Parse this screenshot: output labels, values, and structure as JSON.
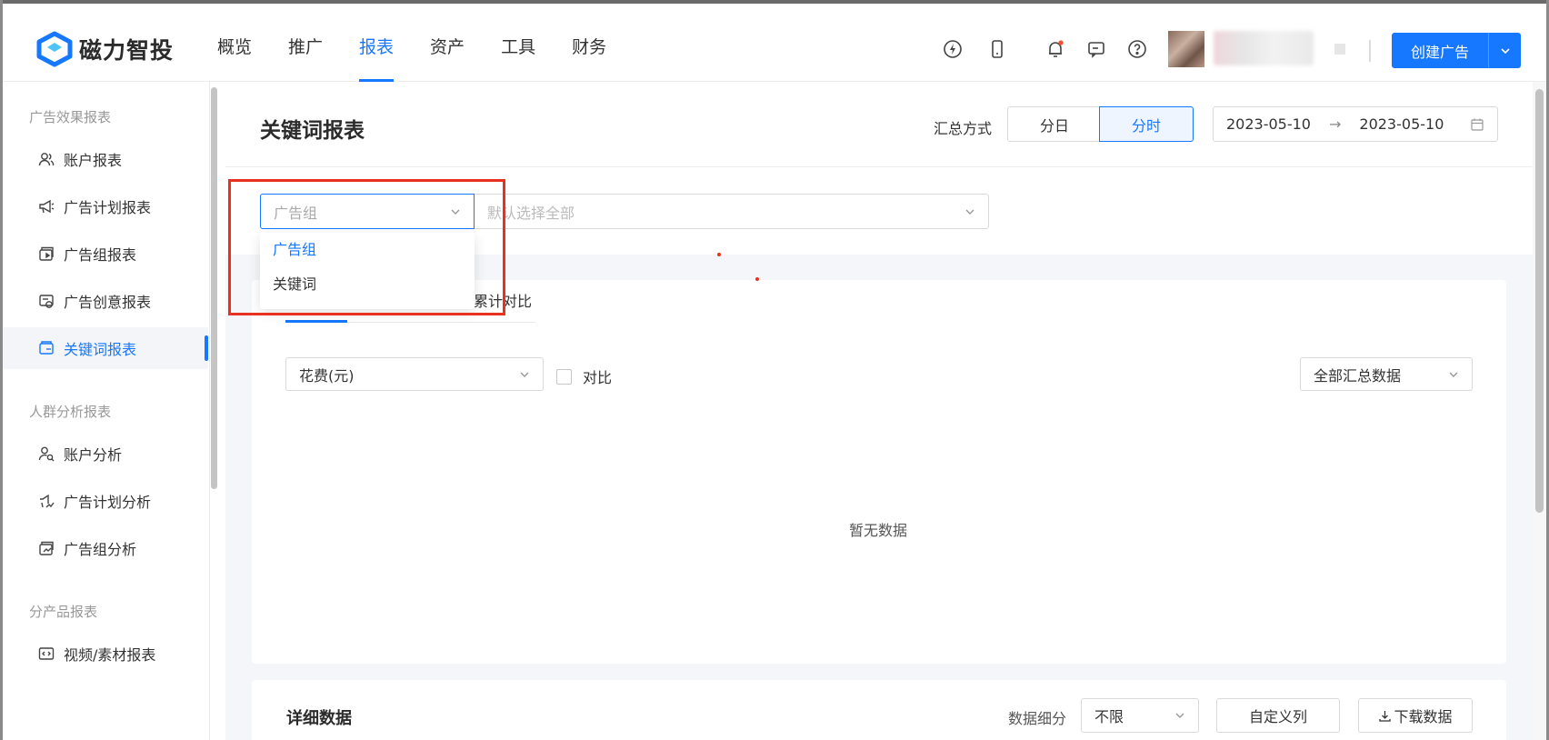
{
  "brand": {
    "name": "磁力智投",
    "color": "#1677ff"
  },
  "nav": {
    "items": [
      {
        "label": "概览",
        "active": false
      },
      {
        "label": "推广",
        "active": false
      },
      {
        "label": "报表",
        "active": true
      },
      {
        "label": "资产",
        "active": false
      },
      {
        "label": "工具",
        "active": false
      },
      {
        "label": "财务",
        "active": false
      }
    ]
  },
  "header": {
    "icons": [
      "lightning-refresh-icon",
      "mobile-icon",
      "bell-icon",
      "message-icon",
      "help-icon"
    ],
    "create_button": "创建广告"
  },
  "sidebar": {
    "groups": [
      {
        "title": "广告效果报表",
        "items": [
          {
            "label": "账户报表",
            "icon": "account-users-icon"
          },
          {
            "label": "广告计划报表",
            "icon": "megaphone-icon"
          },
          {
            "label": "广告组报表",
            "icon": "ad-group-icon"
          },
          {
            "label": "广告创意报表",
            "icon": "creative-icon"
          },
          {
            "label": "关键词报表",
            "icon": "keyword-icon",
            "active": true
          }
        ]
      },
      {
        "title": "人群分析报表",
        "items": [
          {
            "label": "账户分析",
            "icon": "account-search-icon"
          },
          {
            "label": "广告计划分析",
            "icon": "plan-analysis-icon"
          },
          {
            "label": "广告组分析",
            "icon": "group-analysis-icon"
          }
        ]
      },
      {
        "title": "分产品报表",
        "items": [
          {
            "label": "视频/素材报表",
            "icon": "video-code-icon"
          }
        ]
      }
    ]
  },
  "page": {
    "title": "关键词报表",
    "summary_label": "汇总方式",
    "summary_options": [
      "分日",
      "分时"
    ],
    "summary_selected": "分时",
    "date_start": "2023-05-10",
    "date_end": "2023-05-10"
  },
  "filter": {
    "dimension_placeholder": "广告组",
    "scope_placeholder": "默认选择全部",
    "dropdown_options": [
      {
        "label": "广告组",
        "selected": true
      },
      {
        "label": "关键词",
        "selected": false
      }
    ]
  },
  "chart": {
    "tab_cumulative": "累计对比",
    "metric": "花费(元)",
    "compare_label": "对比",
    "summary_select": "全部汇总数据",
    "empty_text": "暂无数据"
  },
  "detail": {
    "title": "详细数据",
    "granularity_label": "数据细分",
    "granularity_value": "不限",
    "custom_columns": "自定义列",
    "download": "下载数据"
  },
  "colors": {
    "accent": "#1677ff",
    "highlight": "#e8321f"
  }
}
